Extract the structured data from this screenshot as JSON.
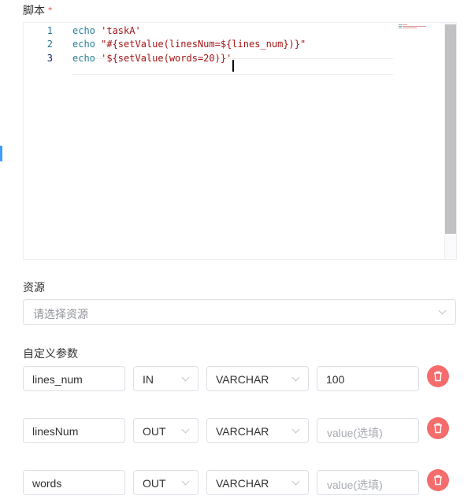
{
  "script": {
    "label": "脚本",
    "required_mark": "*",
    "lines": [
      {
        "num": "1",
        "kw": "echo",
        "str": " 'taskA'"
      },
      {
        "num": "2",
        "kw": "echo",
        "str": " \"#{setValue(linesNum=${lines_num})}\""
      },
      {
        "num": "3",
        "kw": "echo",
        "str": " '${setValue(words=20)}'"
      }
    ]
  },
  "resource": {
    "label": "资源",
    "placeholder": "请选择资源"
  },
  "params": {
    "label": "自定义参数",
    "value_placeholder": "value(选填)",
    "rows": [
      {
        "prop": "lines_num",
        "direct": "IN",
        "type": "VARCHAR",
        "value": "100"
      },
      {
        "prop": "linesNum",
        "direct": "OUT",
        "type": "VARCHAR",
        "value": ""
      },
      {
        "prop": "words",
        "direct": "OUT",
        "type": "VARCHAR",
        "value": ""
      }
    ]
  },
  "colors": {
    "required": "#f56c6c",
    "delete_button": "#f56c6c",
    "keyword": "#267f99",
    "string": "#a31515",
    "line_number": "#237893"
  },
  "icons": {
    "delete": "trash-icon",
    "dropdown": "chevron-down-icon"
  }
}
